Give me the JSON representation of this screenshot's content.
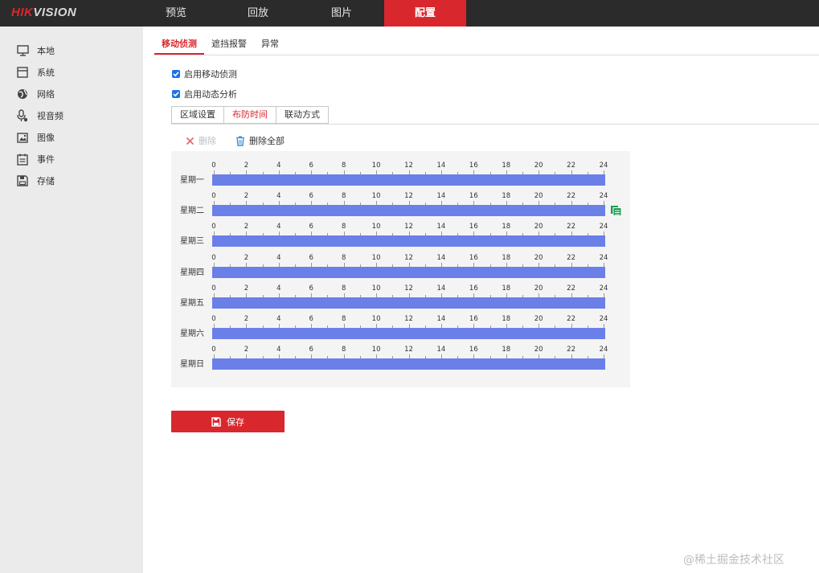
{
  "header": {
    "logo_red": "HIK",
    "logo_rest": "VISION",
    "nav": [
      {
        "label": "预览"
      },
      {
        "label": "回放"
      },
      {
        "label": "图片"
      },
      {
        "label": "配置",
        "active": true
      }
    ]
  },
  "sidebar": {
    "items": [
      {
        "label": "本地",
        "icon": "monitor-icon"
      },
      {
        "label": "系统",
        "icon": "system-icon"
      },
      {
        "label": "网络",
        "icon": "globe-icon"
      },
      {
        "label": "视音频",
        "icon": "mic-camera-icon"
      },
      {
        "label": "图像",
        "icon": "image-icon"
      },
      {
        "label": "事件",
        "icon": "calendar-icon"
      },
      {
        "label": "存储",
        "icon": "storage-icon"
      }
    ]
  },
  "main": {
    "tabs": [
      {
        "label": "移动侦测",
        "active": true
      },
      {
        "label": "遮挡报警"
      },
      {
        "label": "异常"
      }
    ],
    "checkboxes": [
      {
        "label": "启用移动侦测",
        "checked": true
      },
      {
        "label": "启用动态分析",
        "checked": true
      }
    ],
    "subtabs": [
      {
        "label": "区域设置"
      },
      {
        "label": "布防时间",
        "active": true
      },
      {
        "label": "联动方式"
      }
    ],
    "toolbar": {
      "delete_label": "删除",
      "delete_all_label": "删除全部"
    },
    "schedule": {
      "scale": [
        "0",
        "2",
        "4",
        "6",
        "8",
        "10",
        "12",
        "14",
        "16",
        "18",
        "20",
        "22",
        "24"
      ],
      "days": [
        {
          "label": "星期一",
          "start": 0,
          "end": 24
        },
        {
          "label": "星期二",
          "start": 0,
          "end": 24
        },
        {
          "label": "星期三",
          "start": 0,
          "end": 24
        },
        {
          "label": "星期四",
          "start": 0,
          "end": 24
        },
        {
          "label": "星期五",
          "start": 0,
          "end": 24
        },
        {
          "label": "星期六",
          "start": 0,
          "end": 24
        },
        {
          "label": "星期日",
          "start": 0,
          "end": 24
        }
      ]
    },
    "save_label": "保存"
  },
  "watermark": "@稀土掘金技术社区",
  "colors": {
    "accent": "#d9272e",
    "bar": "#6a7fe8",
    "checkbox": "#1a73e8",
    "topbar": "#2b2b2b"
  }
}
